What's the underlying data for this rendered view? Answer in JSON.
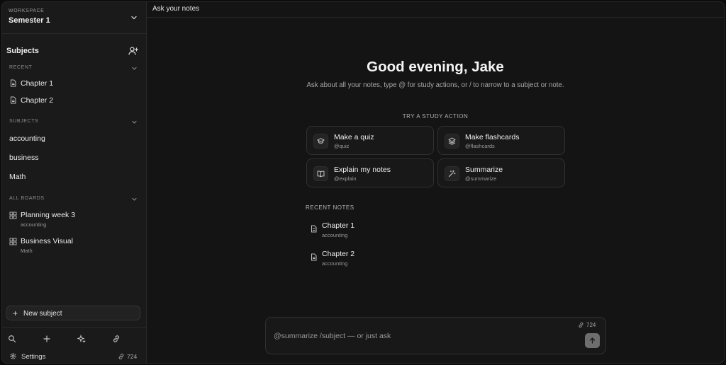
{
  "sidebar": {
    "workspace_label": "WORKSPACE",
    "workspace_name": "Semester 1",
    "subjects_heading": "Subjects",
    "recent_label": "RECENT",
    "recent_items": [
      {
        "label": "Chapter 1"
      },
      {
        "label": "Chapter 2"
      }
    ],
    "subjects_label": "SUBJECTS",
    "subjects": [
      {
        "label": "accounting"
      },
      {
        "label": "business"
      },
      {
        "label": "Math"
      }
    ],
    "boards_label": "ALL BOARDS",
    "boards": [
      {
        "label": "Planning week 3",
        "subject": "accounting"
      },
      {
        "label": "Business Visual",
        "subject": "Math"
      }
    ],
    "new_subject_label": "New subject",
    "settings_label": "Settings",
    "link_count": "724",
    "icons": {
      "workspace": "chevron-down-icon",
      "add_user": "user-plus-icon",
      "search": "search-icon",
      "plus": "plus-icon",
      "sparkle": "sparkle-icon",
      "link": "link-icon",
      "settings": "gear-icon"
    }
  },
  "main": {
    "top_title": "Ask your notes",
    "greeting": "Good evening, Jake",
    "subtitle": "Ask about all your notes, type @ for study actions, or / to narrow to a subject or note.",
    "try_label": "TRY A STUDY ACTION",
    "actions": [
      {
        "title": "Make a quiz",
        "command": "@quiz",
        "icon": "graduation-cap-icon"
      },
      {
        "title": "Make flashcards",
        "command": "@flashcards",
        "icon": "layers-icon"
      },
      {
        "title": "Explain my notes",
        "command": "@explain",
        "icon": "book-open-icon"
      },
      {
        "title": "Summarize",
        "command": "@summarize",
        "icon": "magic-wand-icon"
      }
    ],
    "recent_notes_label": "RECENT NOTES",
    "recent_notes": [
      {
        "title": "Chapter 1",
        "subject": "accounting"
      },
      {
        "title": "Chapter 2",
        "subject": "accounting"
      }
    ],
    "composer": {
      "placeholder": "@summarize /subject — or just ask",
      "link_count": "724",
      "send_icon": "arrow-up-icon"
    }
  },
  "colors": {
    "background": "#0c0c0c",
    "sidebar": "#1a1a1a",
    "panel": "#141414",
    "card": "#181818",
    "border": "#303030",
    "send_button": "#6e6e6e"
  }
}
